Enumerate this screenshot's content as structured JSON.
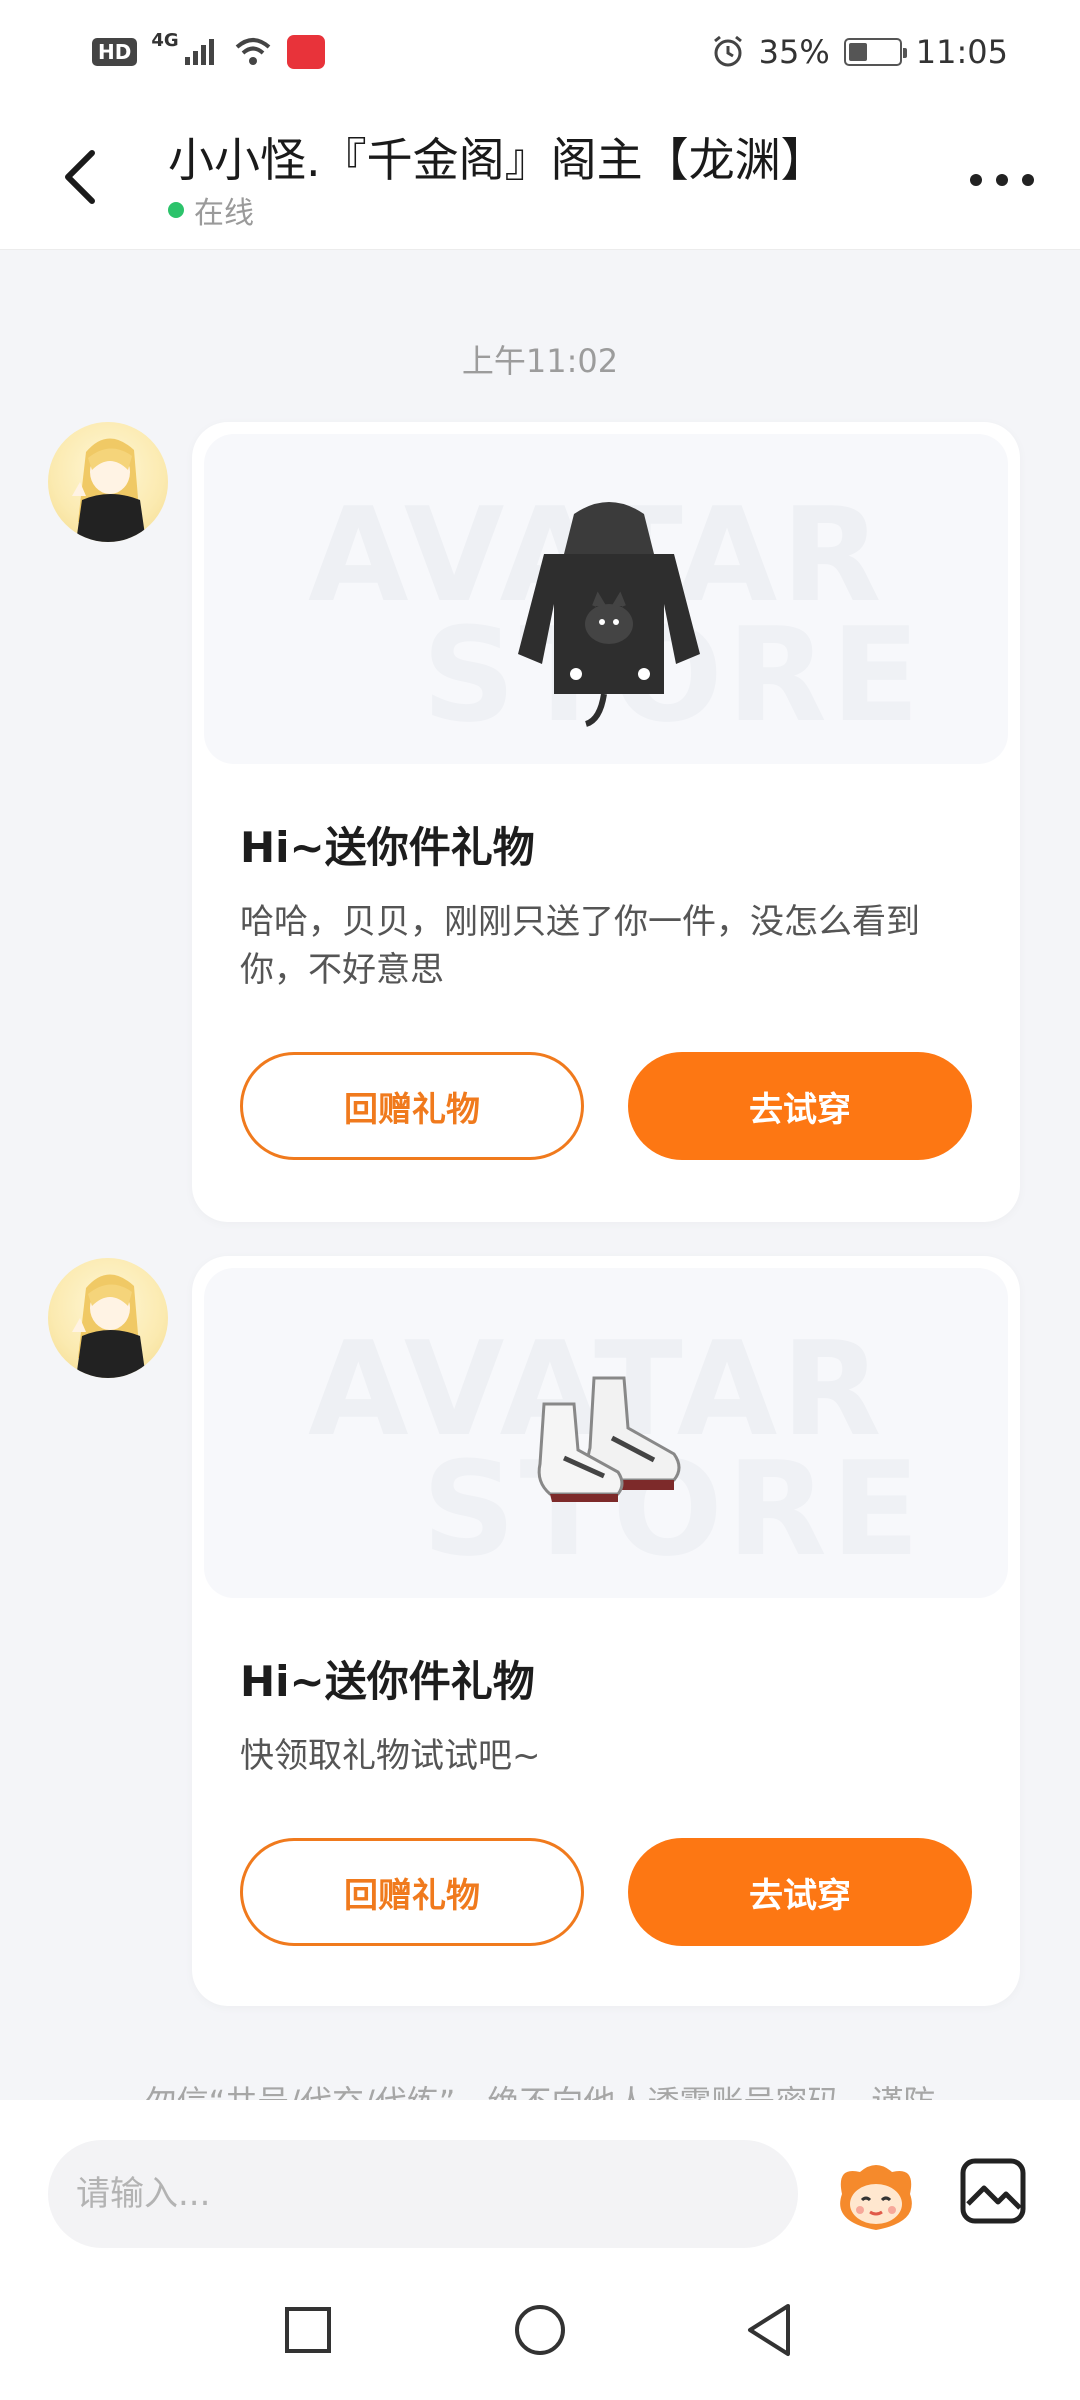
{
  "status_bar": {
    "hd": "HD",
    "network": "4G",
    "battery_text": "35%",
    "battery_level": 0.35,
    "time": "11:05"
  },
  "header": {
    "title": "小小怪.『千金阁』阁主【龙渊】",
    "status": "在线",
    "status_color": "#2cc36b"
  },
  "messages": {
    "timestamp": "上午11:02",
    "cards": [
      {
        "item": "hoodie",
        "watermark_line1": "AVATAR",
        "watermark_line2": "STORE",
        "title": "Hi~送你件礼物",
        "text": "哈哈，贝贝，刚刚只送了你一件，没怎么看到你，不好意思",
        "return_button": "回赠礼物",
        "try_button": "去试穿"
      },
      {
        "item": "sneakers",
        "watermark_line1": "AVATAR",
        "watermark_line2": "STORE",
        "title": "Hi~送你件礼物",
        "text": "快领取礼物试试吧~",
        "return_button": "回赠礼物",
        "try_button": "去试穿"
      }
    ]
  },
  "warning_text": "勿信“共号/代充/代练”，绝不向他人透露账号密码，谨防",
  "input": {
    "placeholder": "请输入..."
  },
  "colors": {
    "accent": "#fd7713",
    "outline": "#f07a1d",
    "background": "#f4f5f8"
  },
  "icons": [
    "back-arrow-icon",
    "more-icon",
    "emoji-mascot-icon",
    "image-icon",
    "square-nav-icon",
    "circle-nav-icon",
    "triangle-nav-icon"
  ]
}
